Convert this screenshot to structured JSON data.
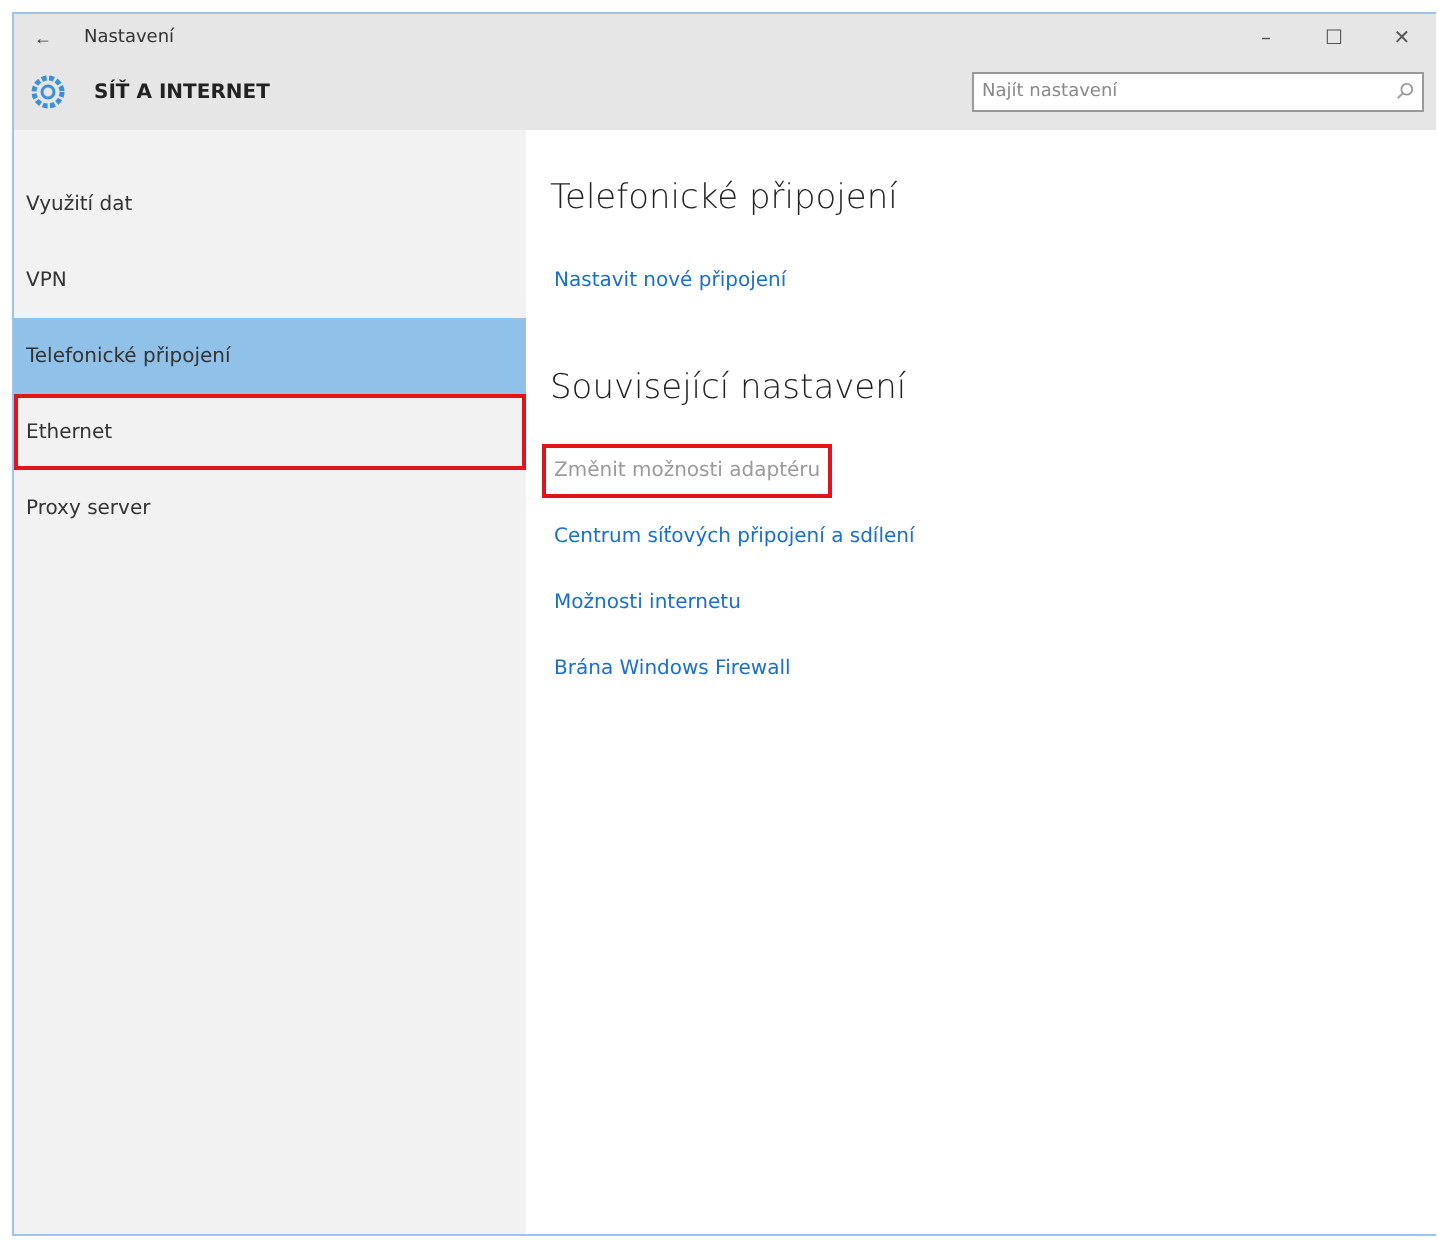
{
  "window": {
    "title": "Nastavení",
    "back": "←",
    "controls": [
      "–",
      "☐",
      "✕"
    ]
  },
  "header": {
    "title": "SÍŤ A INTERNET"
  },
  "search": {
    "placeholder": "Najít nastavení"
  },
  "sidebar": {
    "items": [
      {
        "label": "Využití dat",
        "selected": false,
        "highlighted": false
      },
      {
        "label": "VPN",
        "selected": false,
        "highlighted": false
      },
      {
        "label": "Telefonické připojení",
        "selected": true,
        "highlighted": false
      },
      {
        "label": "Ethernet",
        "selected": false,
        "highlighted": true
      },
      {
        "label": "Proxy server",
        "selected": false,
        "highlighted": false
      }
    ]
  },
  "content": {
    "sections": [
      {
        "heading": "Telefonické připojení",
        "links": [
          {
            "label": "Nastavit nové připojení",
            "disabled": false,
            "highlighted": false
          }
        ]
      },
      {
        "heading": "Související nastavení",
        "links": [
          {
            "label": "Změnit možnosti adaptéru",
            "disabled": true,
            "highlighted": true
          },
          {
            "label": "Centrum síťových připojení a sdílení",
            "disabled": false,
            "highlighted": false
          },
          {
            "label": "Možnosti internetu",
            "disabled": false,
            "highlighted": false
          },
          {
            "label": "Brána Windows Firewall",
            "disabled": false,
            "highlighted": false
          }
        ]
      }
    ]
  }
}
